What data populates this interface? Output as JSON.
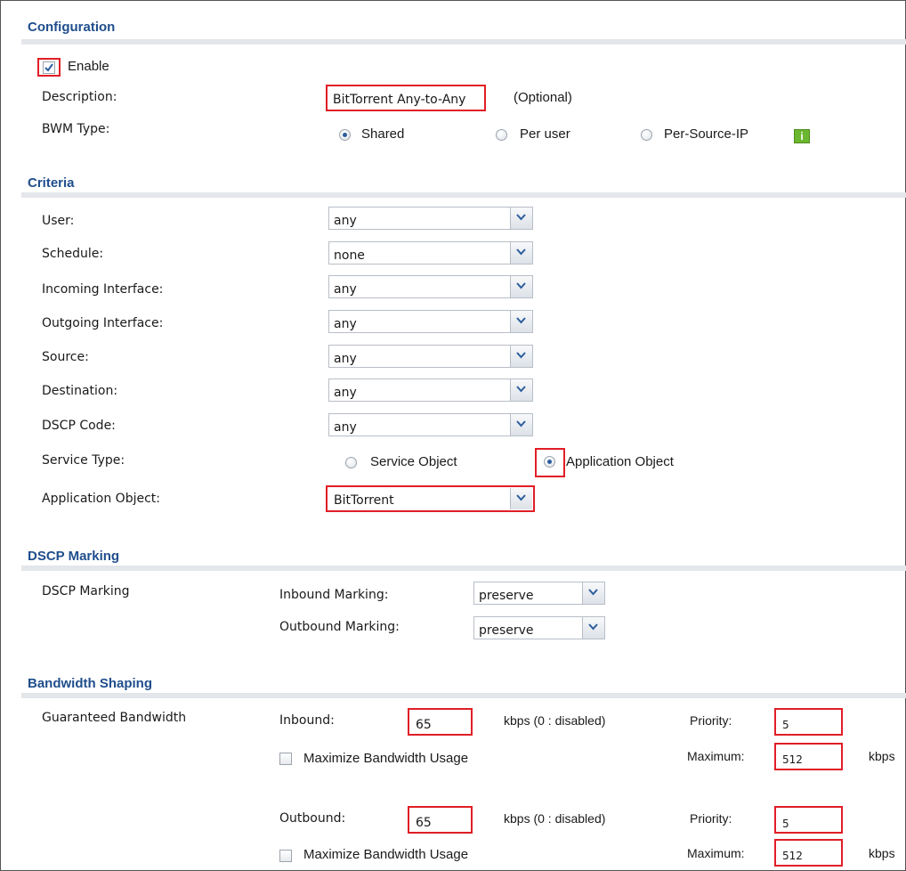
{
  "sections": {
    "configuration": "Configuration",
    "criteria": "Criteria",
    "dscp_marking": "DSCP Marking",
    "bandwidth_shaping": "Bandwidth Shaping"
  },
  "config": {
    "enable_label": "Enable",
    "enable_checked": true,
    "description_label": "Description:",
    "description_value": "BitTorrent Any-to-Any",
    "optional": "(Optional)",
    "bwm_type_label": "BWM Type:",
    "bwm_options": [
      "Shared",
      "Per user",
      "Per-Source-IP"
    ],
    "bwm_selected": "Shared"
  },
  "criteria": {
    "user_label": "User:",
    "user_value": "any",
    "schedule_label": "Schedule:",
    "schedule_value": "none",
    "incoming_label": "Incoming Interface:",
    "incoming_value": "any",
    "outgoing_label": "Outgoing Interface:",
    "outgoing_value": "any",
    "source_label": "Source:",
    "source_value": "any",
    "destination_label": "Destination:",
    "destination_value": "any",
    "dscp_label": "DSCP Code:",
    "dscp_value": "any",
    "service_type_label": "Service Type:",
    "service_object": "Service Object",
    "application_object_option": "Application Object",
    "service_selected": "Application Object",
    "app_object_label": "Application Object:",
    "app_object_value": "BitTorrent"
  },
  "dscp": {
    "label": "DSCP Marking",
    "inbound_label": "Inbound Marking:",
    "inbound_value": "preserve",
    "outbound_label": "Outbound Marking:",
    "outbound_value": "preserve"
  },
  "bandwidth": {
    "guaranteed_label": "Guaranteed Bandwidth",
    "inbound_label": "Inbound:",
    "inbound_value": "65",
    "kbps_disabled": "kbps (0 : disabled)",
    "priority_label": "Priority:",
    "inbound_priority": "5",
    "maximize_label": "Maximize Bandwidth Usage",
    "maximum_label": "Maximum:",
    "inbound_maximum": "512",
    "kbps": "kbps",
    "outbound_label": "Outbound:",
    "outbound_value": "65",
    "outbound_priority": "5",
    "outbound_maximum": "512"
  },
  "icons": {
    "info": "i"
  },
  "colors": {
    "section_title": "#1f4e8c",
    "highlight": "#e01e26",
    "info_icon": "#6bb72f"
  }
}
